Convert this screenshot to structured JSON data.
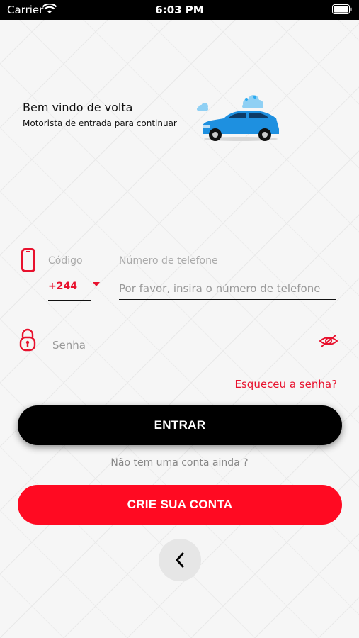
{
  "status_bar": {
    "carrier": "Carrier",
    "time": "6:03 PM"
  },
  "header": {
    "title": "Bem vindo de volta",
    "subtitle": "Motorista de entrada para continuar"
  },
  "login": {
    "code_label": "Código",
    "code_value": "+244",
    "phone_label": "Número de telefone",
    "phone_placeholder": "Por favor, insira o número de telefone",
    "password_placeholder": "Senha",
    "forgot_label": "Esqueceu a senha?",
    "enter_label": "ENTRAR",
    "no_account_text": "Não tem uma conta ainda ?",
    "create_label": "CRIE SUA CONTA"
  },
  "colors": {
    "accent": "#e8112d",
    "primary_button": "#000000",
    "secondary_button": "#ff0a22",
    "car": "#1e90e0"
  },
  "icons": [
    "wifi-icon",
    "battery-icon",
    "car-illustration",
    "phone-icon",
    "lock-icon",
    "eye-off-icon",
    "chevron-left-icon"
  ]
}
